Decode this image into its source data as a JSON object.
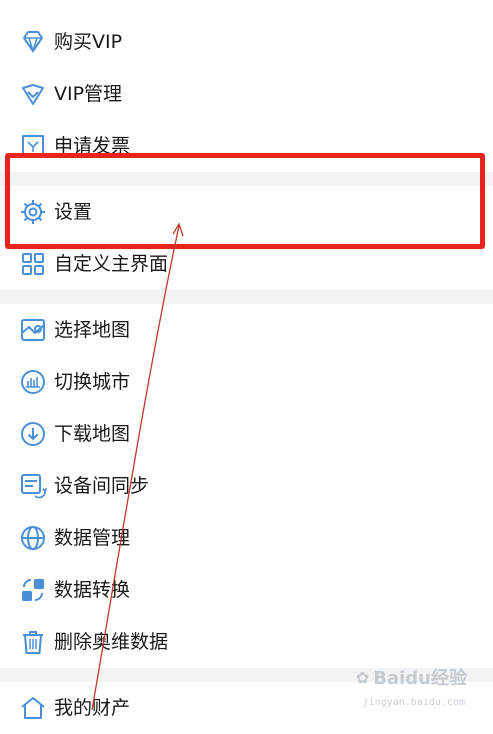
{
  "menu": {
    "items": [
      {
        "label": "购买VIP",
        "icon": "diamond-icon"
      },
      {
        "label": "VIP管理",
        "icon": "vip-badge-icon"
      },
      {
        "label": "申请发票",
        "icon": "invoice-icon"
      },
      {
        "label": "设置",
        "icon": "gear-icon"
      },
      {
        "label": "自定义主界面",
        "icon": "grid-icon"
      },
      {
        "label": "选择地图",
        "icon": "map-icon"
      },
      {
        "label": "切换城市",
        "icon": "city-icon"
      },
      {
        "label": "下载地图",
        "icon": "download-icon"
      },
      {
        "label": "设备间同步",
        "icon": "sync-icon"
      },
      {
        "label": "数据管理",
        "icon": "globe-icon"
      },
      {
        "label": "数据转换",
        "icon": "convert-icon"
      },
      {
        "label": "删除奥维数据",
        "icon": "trash-icon"
      },
      {
        "label": "我的财产",
        "icon": "property-icon"
      }
    ]
  },
  "annotation": {
    "highlight_color": "#e8231c",
    "arrow_color": "#c0392b"
  },
  "watermark": {
    "text": "Baidu经验",
    "url": "jingyan.baidu.com"
  },
  "colors": {
    "icon_blue": "#4a8fd8",
    "separator": "#f2f3f5"
  }
}
